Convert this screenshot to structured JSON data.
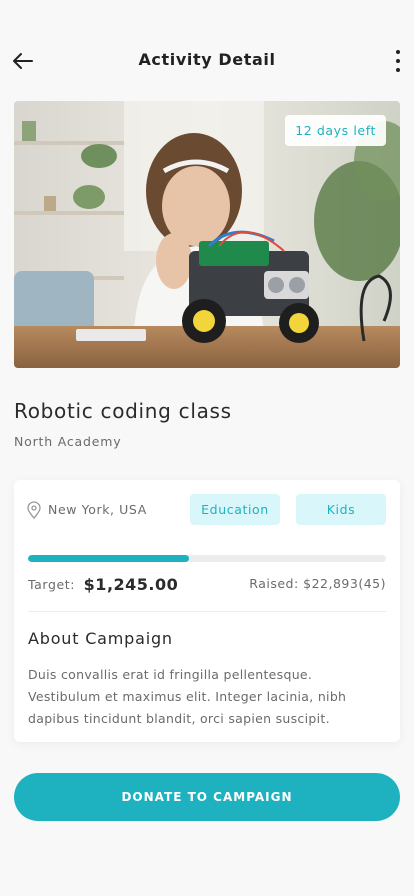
{
  "header": {
    "title": "Activity Detail",
    "back_icon": "arrow-left-icon",
    "more_icon": "more-vertical-icon"
  },
  "hero": {
    "image_alt": "Girl building a robotic car kit",
    "days_left": "12 days left"
  },
  "activity": {
    "title": "Robotic coding class",
    "organizer": "North Academy"
  },
  "details": {
    "location_icon": "map-pin-icon",
    "location": "New York, USA",
    "tags": [
      "Education",
      "Kids"
    ],
    "progress": 0.45,
    "target_label": "Target:",
    "target_value": "$1,245.00",
    "raised": "Raised: $22,893(45)",
    "about_title": "About Campaign",
    "about_body": "Duis convallis erat id fringilla pellentesque. Vestibulum et maximus elit. Integer lacinia, nibh dapibus tincidunt blandit, orci sapien suscipit."
  },
  "cta": {
    "donate_label": "DONATE TO CAMPAIGN"
  },
  "colors": {
    "accent": "#1eb2c0",
    "tag_bg": "#d9f7fb",
    "background": "#f8f8f9"
  }
}
